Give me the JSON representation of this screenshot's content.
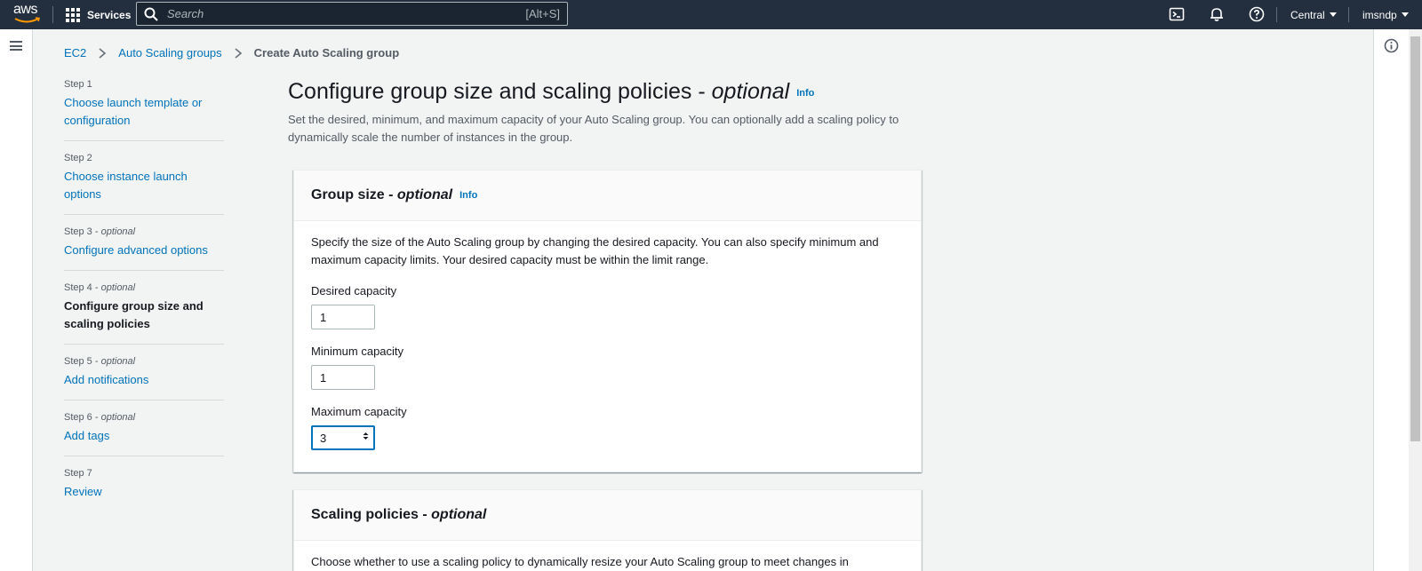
{
  "topnav": {
    "logo_text": "aws",
    "services_label": "Services",
    "search_placeholder": "Search",
    "search_shortcut": "[Alt+S]",
    "region_label": "Central",
    "user_label": "imsndp"
  },
  "breadcrumb": {
    "items": [
      "EC2",
      "Auto Scaling groups"
    ],
    "current": "Create Auto Scaling group"
  },
  "steps": [
    {
      "num": "Step 1",
      "optional": "",
      "label": "Choose launch template or configuration",
      "active": false
    },
    {
      "num": "Step 2",
      "optional": "",
      "label": "Choose instance launch options",
      "active": false
    },
    {
      "num": "Step 3 - ",
      "optional": "optional",
      "label": "Configure advanced options",
      "active": false
    },
    {
      "num": "Step 4 - ",
      "optional": "optional",
      "label": "Configure group size and scaling policies",
      "active": true
    },
    {
      "num": "Step 5 - ",
      "optional": "optional",
      "label": "Add notifications",
      "active": false
    },
    {
      "num": "Step 6 - ",
      "optional": "optional",
      "label": "Add tags",
      "active": false
    },
    {
      "num": "Step 7",
      "optional": "",
      "label": "Review",
      "active": false
    }
  ],
  "page": {
    "title": "Configure group size and scaling policies - ",
    "title_optional": "optional",
    "info": "Info",
    "description": "Set the desired, minimum, and maximum capacity of your Auto Scaling group. You can optionally add a scaling policy to dynamically scale the number of instances in the group."
  },
  "group_size": {
    "title": "Group size - ",
    "title_optional": "optional",
    "info": "Info",
    "description": "Specify the size of the Auto Scaling group by changing the desired capacity. You can also specify minimum and maximum capacity limits. Your desired capacity must be within the limit range.",
    "desired_label": "Desired capacity",
    "desired_value": "1",
    "minimum_label": "Minimum capacity",
    "minimum_value": "1",
    "maximum_label": "Maximum capacity",
    "maximum_value": "3"
  },
  "scaling_policies": {
    "title": "Scaling policies - ",
    "title_optional": "optional",
    "description": "Choose whether to use a scaling policy to dynamically resize your Auto Scaling group to meet changes in"
  }
}
